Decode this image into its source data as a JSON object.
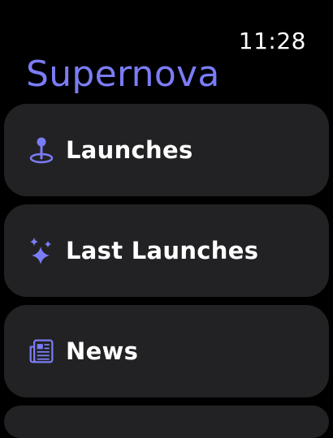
{
  "status": {
    "time": "11:28"
  },
  "app": {
    "title": "Supernova"
  },
  "colors": {
    "accent": "#7b7cf5",
    "card_bg": "#222224",
    "background": "#000000"
  },
  "menu": {
    "items": [
      {
        "label": "Launches",
        "icon": "map-pin-icon"
      },
      {
        "label": "Last Launches",
        "icon": "sparkles-icon"
      },
      {
        "label": "News",
        "icon": "newspaper-icon"
      }
    ]
  }
}
